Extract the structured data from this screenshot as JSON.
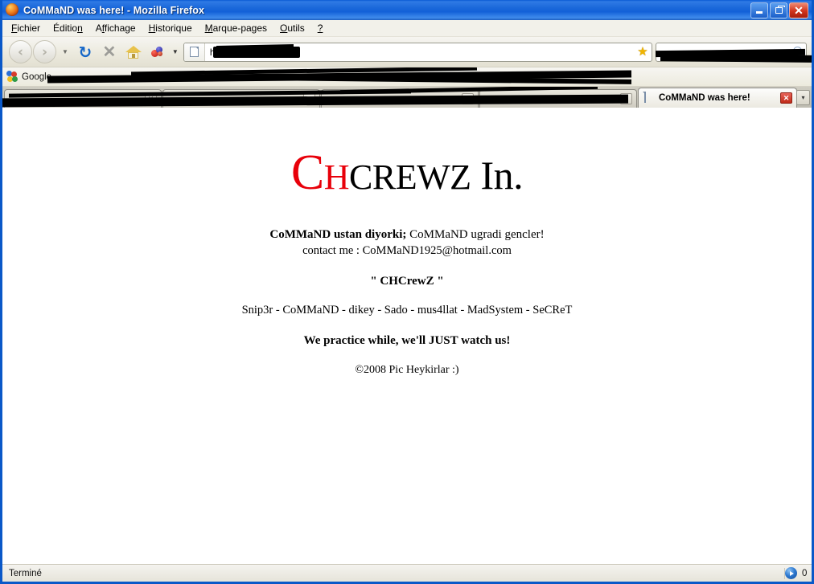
{
  "window": {
    "title": "CoMMaND was here! - Mozilla Firefox",
    "app_icon": "firefox-icon",
    "controls": {
      "minimize": "minimize-button",
      "maximize": "restore-button",
      "close": "close-button"
    }
  },
  "menubar": {
    "items": [
      {
        "label": "Fichier",
        "accesskey": "F"
      },
      {
        "label": "Édition",
        "accesskey": "n"
      },
      {
        "label": "Affichage",
        "accesskey": "A"
      },
      {
        "label": "Historique",
        "accesskey": "H"
      },
      {
        "label": "Marque-pages",
        "accesskey": "M"
      },
      {
        "label": "Outils",
        "accesskey": "O"
      },
      {
        "label": "?",
        "accesskey": "?"
      }
    ]
  },
  "toolbar": {
    "back": "back-button",
    "forward": "forward-button",
    "history_dropdown": "history-dropdown",
    "reload": "reload-button",
    "stop": "stop-button",
    "home": "home-button",
    "bookmarks_blob": "bookmarks-button",
    "url": {
      "value": "ht",
      "placeholder": "",
      "favicon": "page-icon",
      "star": "bookmark-star-icon",
      "redacted": true
    },
    "search": {
      "value": "",
      "placeholder": "",
      "icon": "search-icon",
      "redacted": true
    }
  },
  "bookmarks_bar": {
    "items": [
      {
        "label": "Google",
        "icon": "google-icon"
      }
    ],
    "redacted": true
  },
  "tabs": {
    "inactive": [
      {
        "label": "",
        "redacted": true
      },
      {
        "label": "",
        "redacted": true
      },
      {
        "label": "",
        "redacted": true
      },
      {
        "label": "",
        "redacted": true
      }
    ],
    "active": {
      "label": "CoMMaND was here!",
      "favicon": "page-icon",
      "close": "×"
    },
    "list_all": "▾"
  },
  "page": {
    "title_prefix": "CH",
    "title_rest": "CREWZ",
    "title_suffix": "In.",
    "title_color_red": "#e8000a",
    "lines": {
      "line1_bold": "CoMMaND ustan diyorki;",
      "line1_rest": " CoMMaND ugradi gencler!",
      "line2": "contact me : CoMMaND1925@hotmail.com",
      "line3": "\" CHCrewZ \"",
      "line4": "Snip3r - CoMMaND - dikey - Sado - mus4llat - MadSystem - SeCReT",
      "line5": "We practice while, we'll JUST watch us!",
      "line6": "©2008 Pic Heykirlar :)"
    }
  },
  "statusbar": {
    "text": "Terminé",
    "count": "0",
    "orb_icon": "play-orb-icon"
  }
}
